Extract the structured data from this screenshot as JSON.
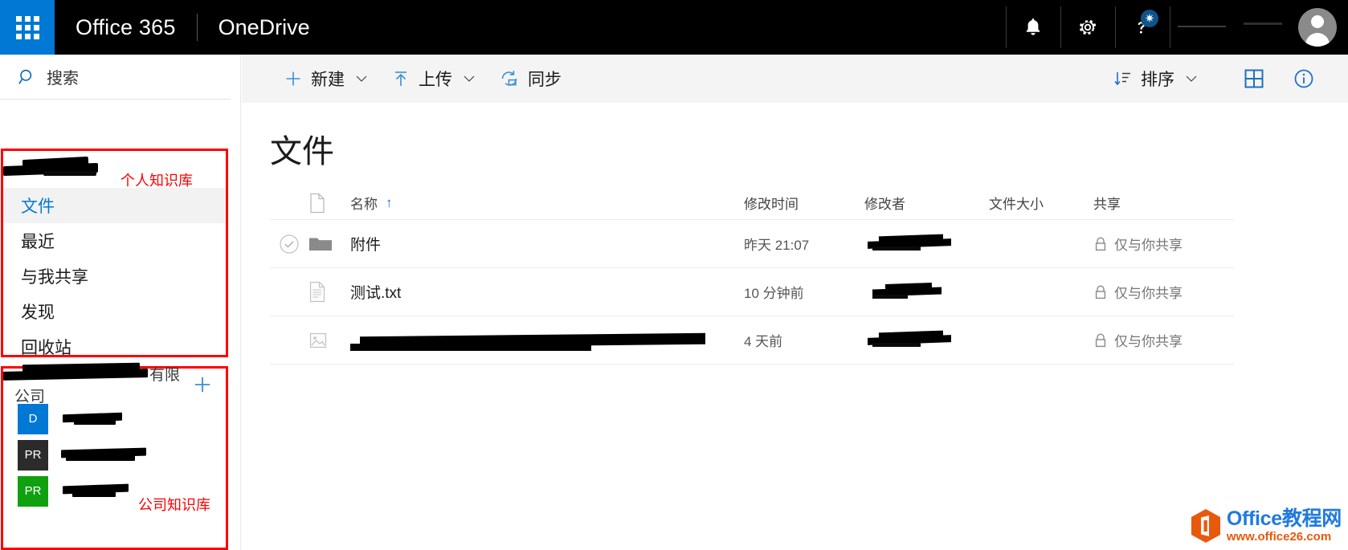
{
  "suite": {
    "waffle_label": "app-launcher",
    "brand": "Office 365",
    "app": "OneDrive",
    "notifications_icon": "bell-icon",
    "settings_icon": "gear-icon",
    "help_icon": "help-question-icon",
    "help_badge_glyph": "✷",
    "avatar_label": "account-avatar"
  },
  "sidebar": {
    "search": {
      "placeholder": "搜索",
      "icon": "search-icon"
    },
    "nav_items": [
      {
        "label": "文件",
        "selected": true
      },
      {
        "label": "最近",
        "selected": false
      },
      {
        "label": "与我共享",
        "selected": false
      },
      {
        "label": "发现",
        "selected": false
      },
      {
        "label": "回收站",
        "selected": false
      }
    ],
    "personal_annotation": "个人知识库",
    "company_annotation": "公司知识库",
    "sites_header": {
      "company_suffix": "有限公司",
      "add_icon": "plus-icon"
    },
    "sites": [
      {
        "badge": "D",
        "color": "#0078d4"
      },
      {
        "badge": "PR",
        "color": "#2b2b2b"
      },
      {
        "badge": "PR",
        "color": "#10a010"
      }
    ]
  },
  "commandbar": {
    "new_label": "新建",
    "new_icon": "plus-icon",
    "upload_label": "上传",
    "upload_icon": "upload-arrow-icon",
    "sync_label": "同步",
    "sync_icon": "sync-icon",
    "sort_label": "排序",
    "sort_icon": "sort-descending-icon",
    "view_icon": "tiles-view-icon",
    "info_icon": "information-icon",
    "chevron_icon": "chevron-down-icon"
  },
  "main": {
    "title": "文件",
    "columns": {
      "name": "名称",
      "modified": "修改时间",
      "modified_by": "修改者",
      "size": "文件大小",
      "sharing": "共享",
      "sort_indicator": "↑",
      "name_icon": "document-icon"
    },
    "rows": [
      {
        "name": "附件",
        "icon": "folder-icon",
        "checkbox": "circle-check-icon",
        "modified": "昨天 21:07",
        "modified_by": "",
        "size": "",
        "sharing": "仅与你共享",
        "sharing_icon": "lock-icon",
        "redacted_name": false
      },
      {
        "name": "测试.txt",
        "icon": "text-file-icon",
        "checkbox": "",
        "modified": "10 分钟前",
        "modified_by": "",
        "size": "",
        "sharing": "仅与你共享",
        "sharing_icon": "lock-icon",
        "redacted_name": false
      },
      {
        "name": "",
        "icon": "image-file-icon",
        "checkbox": "",
        "modified": "4 天前",
        "modified_by": "",
        "size": "",
        "sharing": "仅与你共享",
        "sharing_icon": "lock-icon",
        "redacted_name": true
      }
    ]
  },
  "watermark": {
    "title": "Office教程网",
    "url": "www.office26.com",
    "logo_icon": "office-hexagon-logo"
  },
  "colors": {
    "accent": "#0078d4",
    "header_bg": "#000000",
    "commandbar_bg": "#f4f4f4",
    "annotation_red": "#ff0000",
    "selected_bg": "#f2f2f2"
  }
}
